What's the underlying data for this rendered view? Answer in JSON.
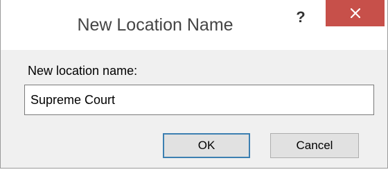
{
  "window": {
    "title": "New Location Name",
    "help_label": "?",
    "close_icon": "close-icon",
    "close_color": "#c7504a"
  },
  "form": {
    "field_label": "New location name:",
    "field_value": "Supreme Court"
  },
  "buttons": {
    "ok_label": "OK",
    "cancel_label": "Cancel"
  },
  "colors": {
    "dialog_background": "#f0f0f0",
    "default_button_border": "#3c7fb1"
  }
}
